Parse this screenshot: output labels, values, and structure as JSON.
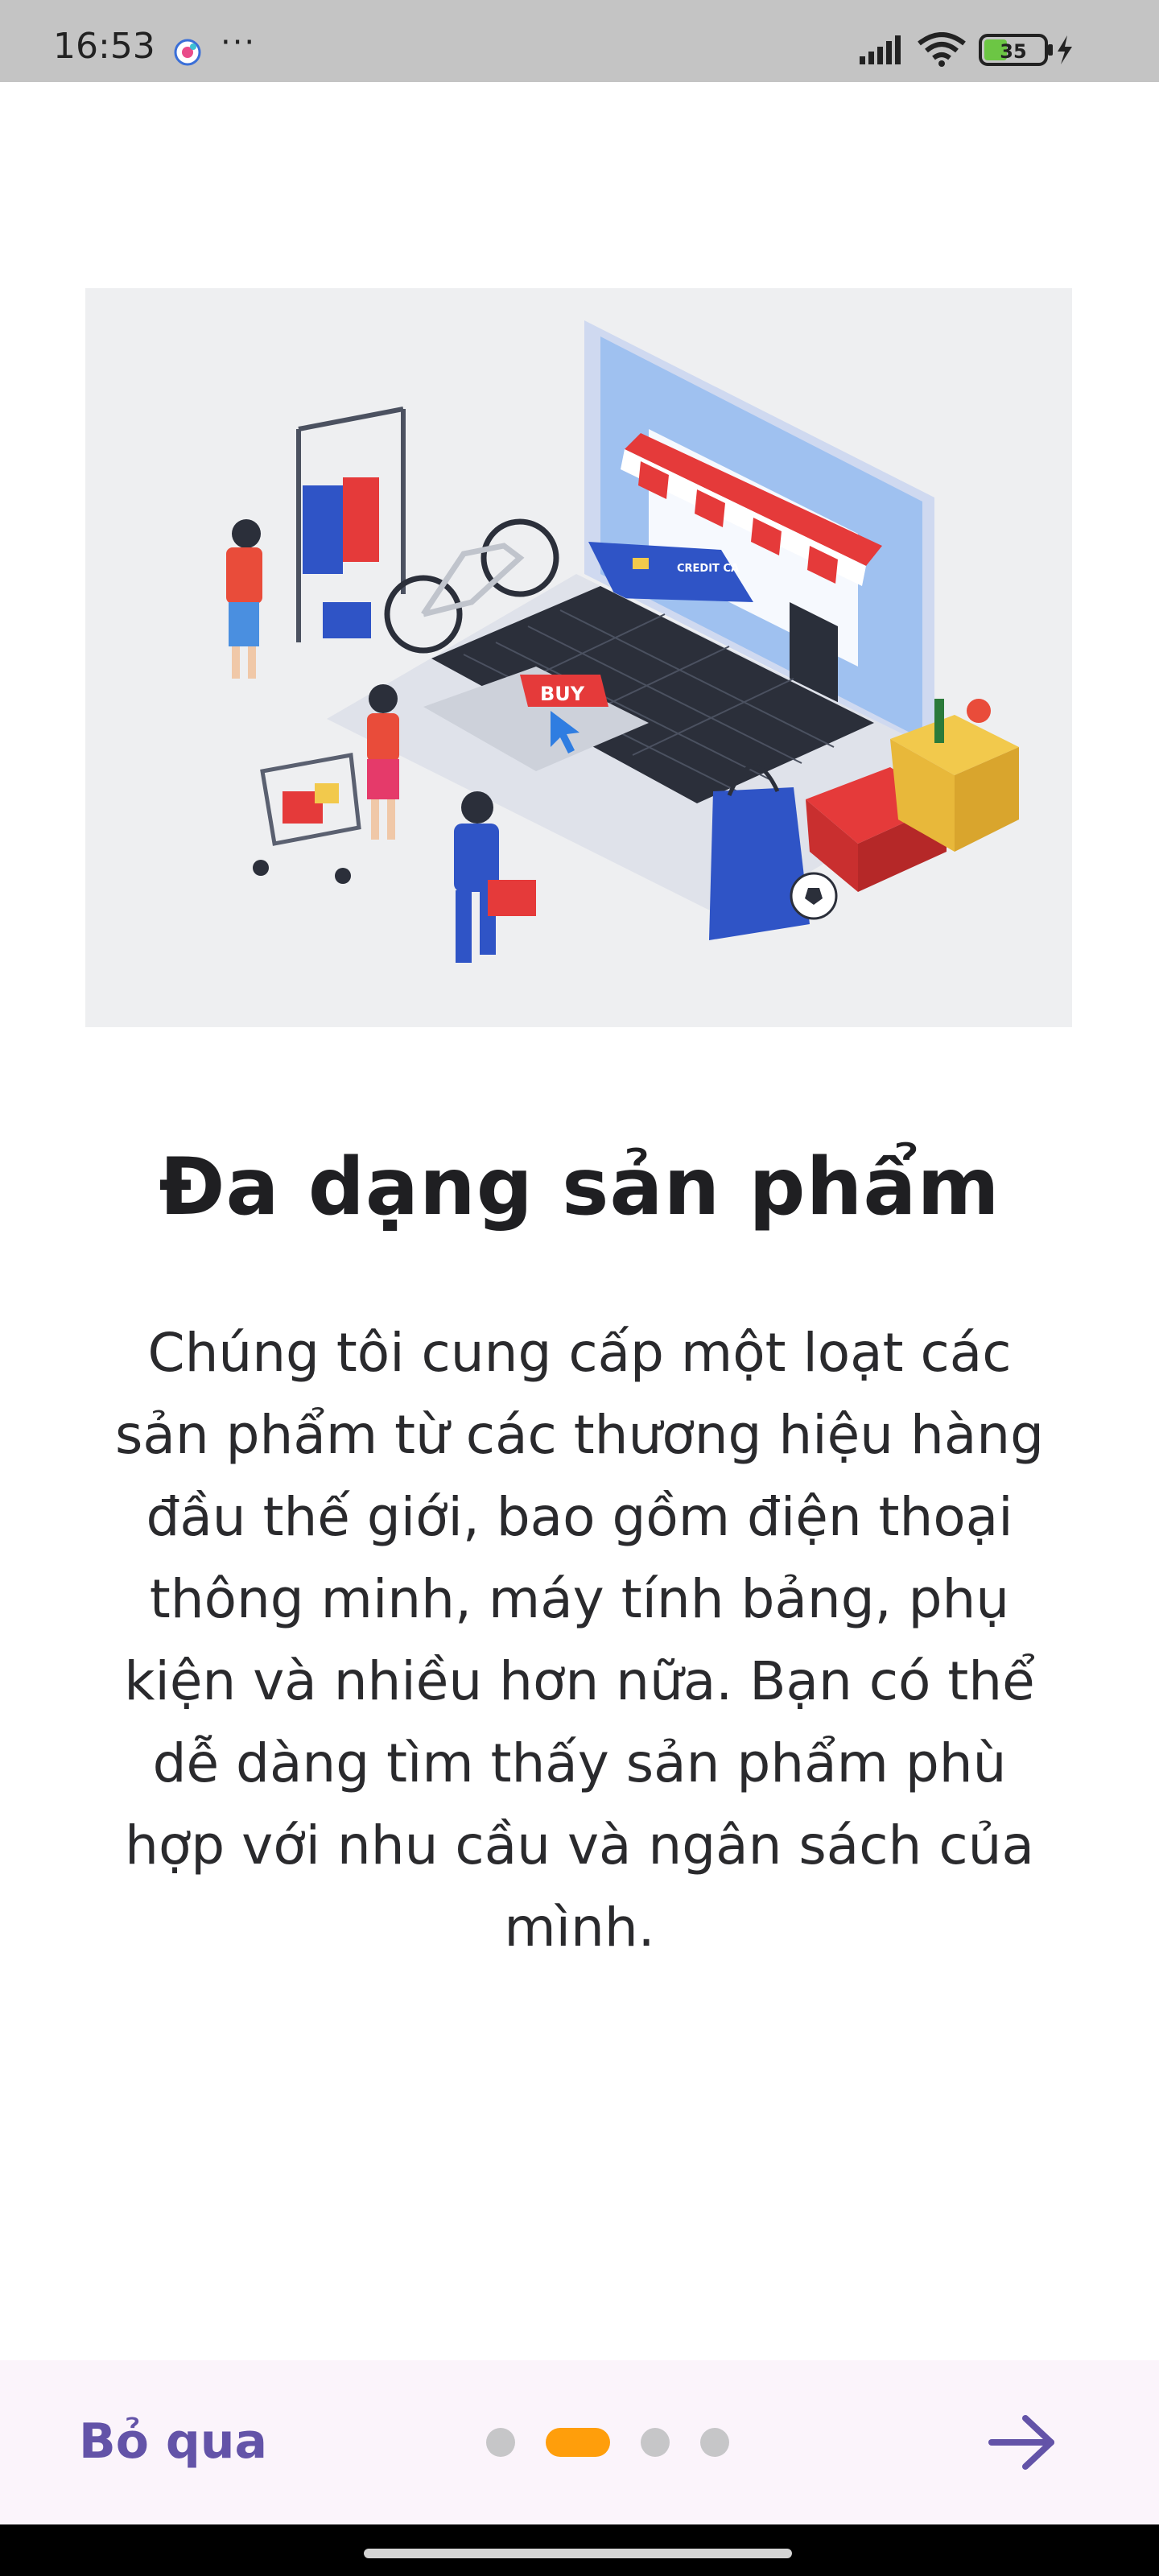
{
  "status_bar": {
    "time": "16:53",
    "more": "···",
    "battery_level": "35",
    "icons": [
      "app-notification-icon",
      "more-dots-icon",
      "signal-icon",
      "wifi-icon",
      "battery-icon",
      "charging-icon"
    ]
  },
  "hero": {
    "image": "online-shopping-illustration-icon",
    "card_text": "CREDIT CA",
    "buy_label": "BUY"
  },
  "onboarding": {
    "title": "Đa dạng sản phẩm",
    "description": "Chúng tôi cung cấp một loạt các sản phẩm từ các thương hiệu hàng đầu thế giới, bao gồm điện thoại thông minh, máy tính bảng, phụ kiện và nhiều hơn nữa. Bạn có thể dễ dàng tìm thấy sản phẩm phù hợp với nhu cầu và ngân sách của mình."
  },
  "bottom_bar": {
    "skip_label": "Bỏ qua",
    "pages": 4,
    "active_page": 2,
    "accent_color": "#6353a8",
    "active_dot_color": "#ff9e0b",
    "next_icon": "arrow-right-icon"
  }
}
